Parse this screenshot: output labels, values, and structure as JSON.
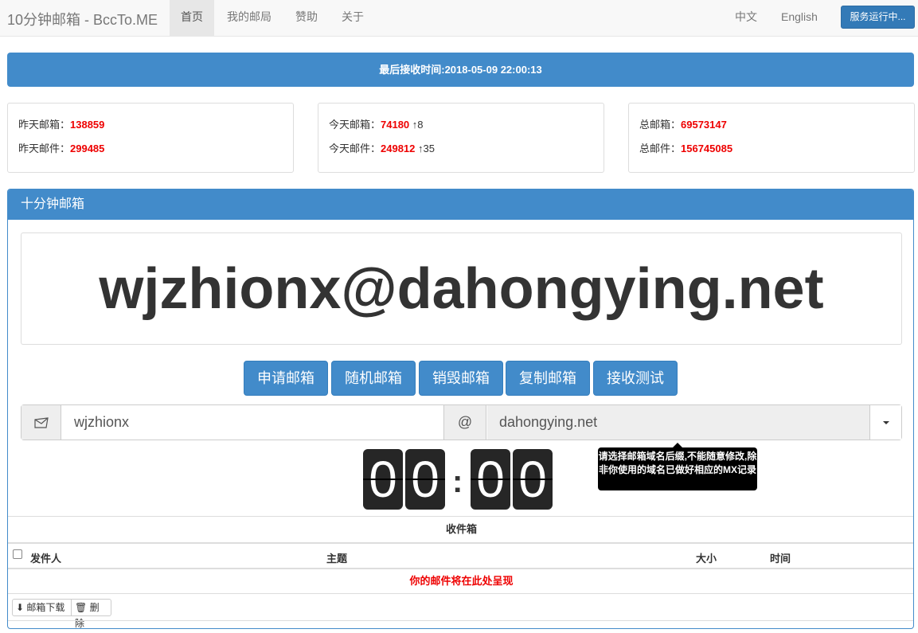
{
  "navbar": {
    "brand": "10分钟邮箱 - BccTo.ME",
    "items": [
      "首页",
      "我的邮局",
      "赞助",
      "关于"
    ],
    "lang_zh": "中文",
    "lang_en": "English",
    "status_button": "服务运行中..."
  },
  "last_receive": "最后接收时间:2018-05-09 22:00:13",
  "stats": {
    "yesterday": {
      "mailbox_label": "昨天邮箱：",
      "mailbox_value": "138859",
      "mail_label": "昨天邮件：",
      "mail_value": "299485"
    },
    "today": {
      "mailbox_label": "今天邮箱：",
      "mailbox_value": "74180",
      "mailbox_inc": "↑8",
      "mail_label": "今天邮件：",
      "mail_value": "249812",
      "mail_inc": "↑35"
    },
    "total": {
      "mailbox_label": "总邮箱：",
      "mailbox_value": "69573147",
      "mail_label": "总邮件：",
      "mail_value": "156745085"
    }
  },
  "panel": {
    "title": "十分钟邮箱",
    "email": "wjzhionx@dahongying.net",
    "buttons": [
      "申请邮箱",
      "随机邮箱",
      "销毁邮箱",
      "复制邮箱",
      "接收测试"
    ],
    "username": "wjzhionx",
    "at": "@",
    "domain": "dahongying.net",
    "timer": {
      "m1": "0",
      "m2": "0",
      "s1": "0",
      "s2": "0"
    },
    "tooltip": "请选择邮箱域名后缀,不能随意修改,除非你使用的域名已做好相应的MX记录"
  },
  "inbox": {
    "title": "收件箱",
    "columns": [
      "发件人",
      "主题",
      "大小",
      "时间"
    ],
    "empty_message": "你的邮件将在此处呈现",
    "download_button": "邮箱下载",
    "delete_button": "删除"
  },
  "colors": {
    "primary": "#428bca",
    "accent_red": "#ee0000"
  }
}
